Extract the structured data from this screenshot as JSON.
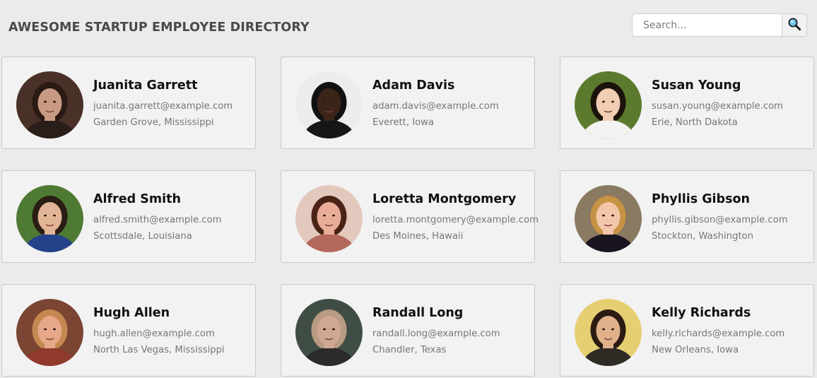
{
  "header": {
    "title": "AWESOME STARTUP EMPLOYEE DIRECTORY"
  },
  "search": {
    "placeholder": "Search...",
    "value": "",
    "button_icon": "magnifying-glass-icon"
  },
  "employees": [
    {
      "name": "Juanita Garrett",
      "email": "juanita.garrett@example.com",
      "location": "Garden Grove, Mississippi",
      "avatar": {
        "bg": "#4a3128",
        "hair": "#2b1a14",
        "skin": "#c99a83",
        "shirt": "#2a1e1a"
      }
    },
    {
      "name": "Adam Davis",
      "email": "adam.davis@example.com",
      "location": "Everett, Iowa",
      "avatar": {
        "bg": "#ececec",
        "hair": "#111111",
        "skin": "#3b2519",
        "shirt": "#161616"
      }
    },
    {
      "name": "Susan Young",
      "email": "susan.young@example.com",
      "location": "Erie, North Dakota",
      "avatar": {
        "bg": "#5c7a2e",
        "hair": "#1c120c",
        "skin": "#f0cdb3",
        "shirt": "#f3f3f1"
      }
    },
    {
      "name": "Alfred Smith",
      "email": "alfred.smith@example.com",
      "location": "Scottsdale, Louisiana",
      "avatar": {
        "bg": "#4f7a34",
        "hair": "#2a1d14",
        "skin": "#e2b596",
        "shirt": "#24428a"
      }
    },
    {
      "name": "Loretta Montgomery",
      "email": "loretta.montgomery@example.com",
      "location": "Des Moines, Hawaii",
      "avatar": {
        "bg": "#e3c9bd",
        "hair": "#4a2216",
        "skin": "#e8ad97",
        "shirt": "#b2685a"
      }
    },
    {
      "name": "Phyllis Gibson",
      "email": "phyllis.gibson@example.com",
      "location": "Stockton, Washington",
      "avatar": {
        "bg": "#8a7a62",
        "hair": "#c79244",
        "skin": "#f1c6a9",
        "shirt": "#1a1420"
      }
    },
    {
      "name": "Hugh Allen",
      "email": "hugh.allen@example.com",
      "location": "North Las Vegas, Mississippi",
      "avatar": {
        "bg": "#7a4532",
        "hair": "#c48850",
        "skin": "#e6a888",
        "shirt": "#8f3a2c"
      }
    },
    {
      "name": "Randall Long",
      "email": "randall.long@example.com",
      "location": "Chandler, Texas",
      "avatar": {
        "bg": "#3f4d44",
        "hair": "#b99a84",
        "skin": "#cfa893",
        "shirt": "#2b2b2b"
      }
    },
    {
      "name": "Kelly Richards",
      "email": "kelly.richards@example.com",
      "location": "New Orleans, Iowa",
      "avatar": {
        "bg": "#e6cf72",
        "hair": "#2b1b12",
        "skin": "#e0b18a",
        "shirt": "#2e2a24"
      }
    }
  ]
}
